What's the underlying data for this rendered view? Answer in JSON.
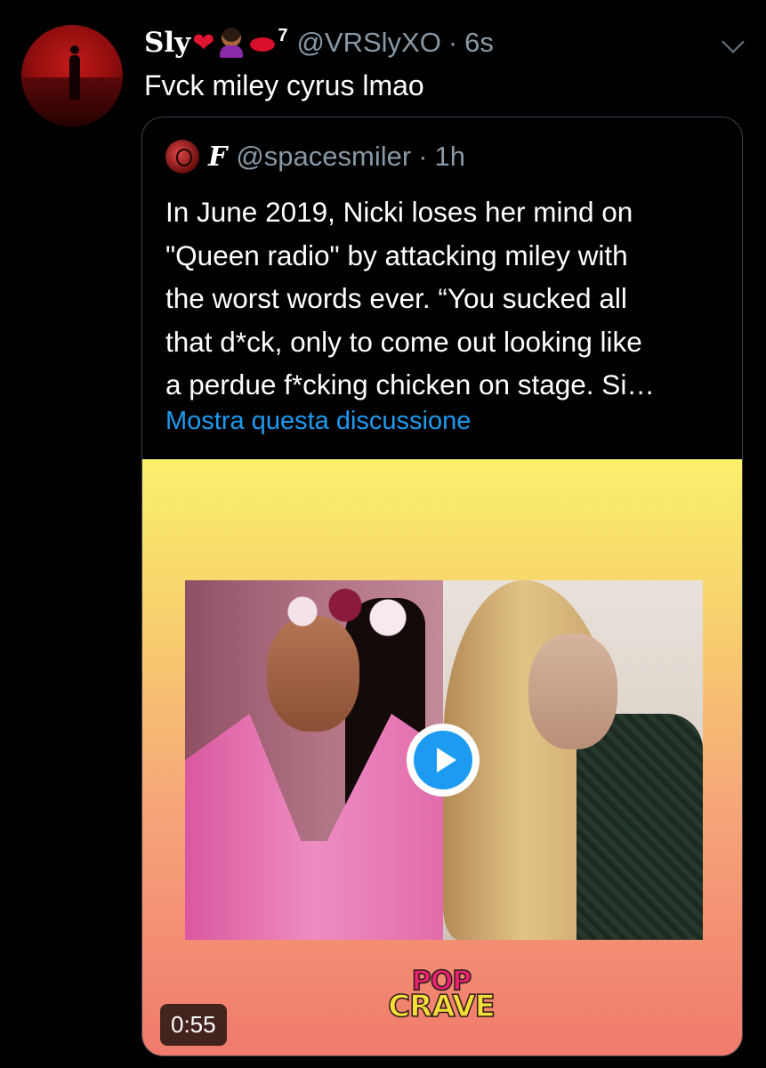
{
  "tweet": {
    "display_name": "Sly",
    "name_emojis": [
      "red-heart",
      "woman-emoji",
      "kiss-mark"
    ],
    "superscript": "7",
    "handle": "@VRSlyXO",
    "separator": "·",
    "time": "6s",
    "text": "Fvck miley cyrus lmao"
  },
  "quoted_tweet": {
    "name_glyph": "F",
    "handle": "@spacesmiler",
    "separator": "·",
    "time": "1h",
    "text_lines": [
      "In June 2019, Nicki loses her mind on",
      "\"Queen radio\" by attacking miley with",
      "the worst words ever. “You sucked all",
      "that d*ck, only to come out looking like",
      "a perdue f*cking chicken on stage. Si…"
    ],
    "show_thread_link": "Mostra questa discussione"
  },
  "media": {
    "duration": "0:55",
    "logo_top": "POP",
    "logo_bottom": "CRAVE",
    "icon": "play-icon"
  },
  "colors": {
    "background": "#000000",
    "link": "#1d9bf0",
    "secondary_text": "#8899a6",
    "border": "#38444d"
  }
}
